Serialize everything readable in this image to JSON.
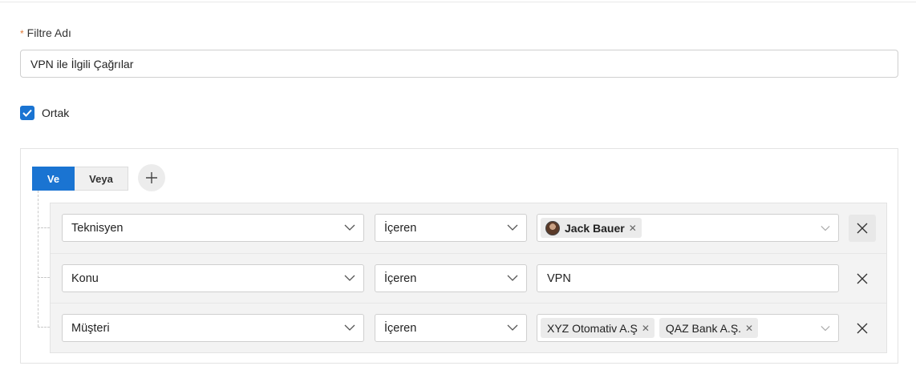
{
  "form": {
    "name_label": "Filtre Adı",
    "required_mark": "*",
    "name_value": "VPN ile İlgili Çağrılar",
    "shared_label": "Ortak",
    "shared_checked": true
  },
  "builder": {
    "logic": {
      "and_label": "Ve",
      "or_label": "Veya",
      "selected": "Ve"
    },
    "add_icon": "plus-icon",
    "rules": [
      {
        "field": "Teknisyen",
        "operator": "İçeren",
        "value_type": "tags",
        "tags": [
          {
            "label": "Jack Bauer",
            "avatar": true
          }
        ]
      },
      {
        "field": "Konu",
        "operator": "İçeren",
        "value_type": "text",
        "value": "VPN"
      },
      {
        "field": "Müşteri",
        "operator": "İçeren",
        "value_type": "tags",
        "tags": [
          {
            "label": "XYZ Otomativ A.Ş"
          },
          {
            "label": "QAZ Bank A.Ş."
          }
        ]
      }
    ]
  },
  "colors": {
    "accent": "#1a74d2",
    "required": "#e07b39"
  }
}
